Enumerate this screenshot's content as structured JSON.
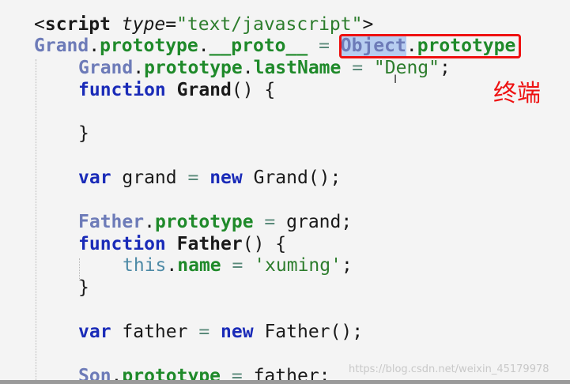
{
  "annotation": {
    "label": "终端",
    "color": "#ee1111"
  },
  "cursor_glyph": "I",
  "watermark": "https://blog.csdn.net/weixin_45179978",
  "colors": {
    "background": "#f4f4f4",
    "keyword": "#1a2bb8",
    "class_name": "#6d7bb8",
    "property": "#1f8a2a",
    "string": "#2d7d2d",
    "highlight": "#b7cdf0"
  },
  "code_lines": [
    {
      "tokens": [
        {
          "t": "<",
          "k": "punct"
        },
        {
          "t": "script",
          "k": "tag"
        },
        {
          "t": " ",
          "k": "plain"
        },
        {
          "t": "type",
          "k": "attr"
        },
        {
          "t": "=",
          "k": "punct"
        },
        {
          "t": "\"text/javascript\"",
          "k": "str"
        },
        {
          "t": ">",
          "k": "punct"
        }
      ]
    },
    {
      "tokens": [
        {
          "t": "Grand",
          "k": "cls"
        },
        {
          "t": ".",
          "k": "plain"
        },
        {
          "t": "prototype",
          "k": "prop"
        },
        {
          "t": ".",
          "k": "plain"
        },
        {
          "t": "__proto__",
          "k": "prop"
        },
        {
          "t": " = ",
          "k": "op"
        },
        {
          "t": "Object",
          "k": "cls",
          "hl": true
        },
        {
          "t": ".",
          "k": "plain"
        },
        {
          "t": "prototype",
          "k": "prop"
        }
      ]
    },
    {
      "tokens": [
        {
          "t": "Grand",
          "k": "cls"
        },
        {
          "t": ".",
          "k": "plain"
        },
        {
          "t": "prototype",
          "k": "prop"
        },
        {
          "t": ".",
          "k": "plain"
        },
        {
          "t": "lastName",
          "k": "prop"
        },
        {
          "t": " = ",
          "k": "op"
        },
        {
          "t": "\"Deng\"",
          "k": "str"
        },
        {
          "t": ";",
          "k": "punct"
        }
      ]
    },
    {
      "tokens": [
        {
          "t": "function",
          "k": "kw"
        },
        {
          "t": " ",
          "k": "plain"
        },
        {
          "t": "Grand",
          "k": "fn"
        },
        {
          "t": "() {",
          "k": "punct"
        }
      ]
    },
    {
      "tokens": []
    },
    {
      "tokens": [
        {
          "t": "}",
          "k": "punct"
        }
      ]
    },
    {
      "tokens": []
    },
    {
      "tokens": [
        {
          "t": "var",
          "k": "kw"
        },
        {
          "t": " grand ",
          "k": "plain"
        },
        {
          "t": "=",
          "k": "op"
        },
        {
          "t": " ",
          "k": "plain"
        },
        {
          "t": "new",
          "k": "kw"
        },
        {
          "t": " Grand();",
          "k": "plain"
        }
      ]
    },
    {
      "tokens": []
    },
    {
      "tokens": [
        {
          "t": "Father",
          "k": "cls"
        },
        {
          "t": ".",
          "k": "plain"
        },
        {
          "t": "prototype",
          "k": "prop"
        },
        {
          "t": " = ",
          "k": "op"
        },
        {
          "t": "grand;",
          "k": "plain"
        }
      ]
    },
    {
      "tokens": [
        {
          "t": "function",
          "k": "kw"
        },
        {
          "t": " ",
          "k": "plain"
        },
        {
          "t": "Father",
          "k": "fn"
        },
        {
          "t": "() {",
          "k": "punct"
        }
      ]
    },
    {
      "tokens": [
        {
          "t": "this",
          "k": "thiskw"
        },
        {
          "t": ".",
          "k": "plain"
        },
        {
          "t": "name",
          "k": "prop"
        },
        {
          "t": " = ",
          "k": "op"
        },
        {
          "t": "'xuming'",
          "k": "str"
        },
        {
          "t": ";",
          "k": "punct"
        }
      ]
    },
    {
      "tokens": [
        {
          "t": "}",
          "k": "punct"
        }
      ]
    },
    {
      "tokens": []
    },
    {
      "tokens": [
        {
          "t": "var",
          "k": "kw"
        },
        {
          "t": " father ",
          "k": "plain"
        },
        {
          "t": "=",
          "k": "op"
        },
        {
          "t": " ",
          "k": "plain"
        },
        {
          "t": "new",
          "k": "kw"
        },
        {
          "t": " Father();",
          "k": "plain"
        }
      ]
    },
    {
      "tokens": []
    },
    {
      "tokens": [
        {
          "t": "Son",
          "k": "cls"
        },
        {
          "t": ".",
          "k": "plain"
        },
        {
          "t": "prototype",
          "k": "prop"
        },
        {
          "t": " = ",
          "k": "op"
        },
        {
          "t": "father;",
          "k": "plain"
        }
      ]
    }
  ]
}
